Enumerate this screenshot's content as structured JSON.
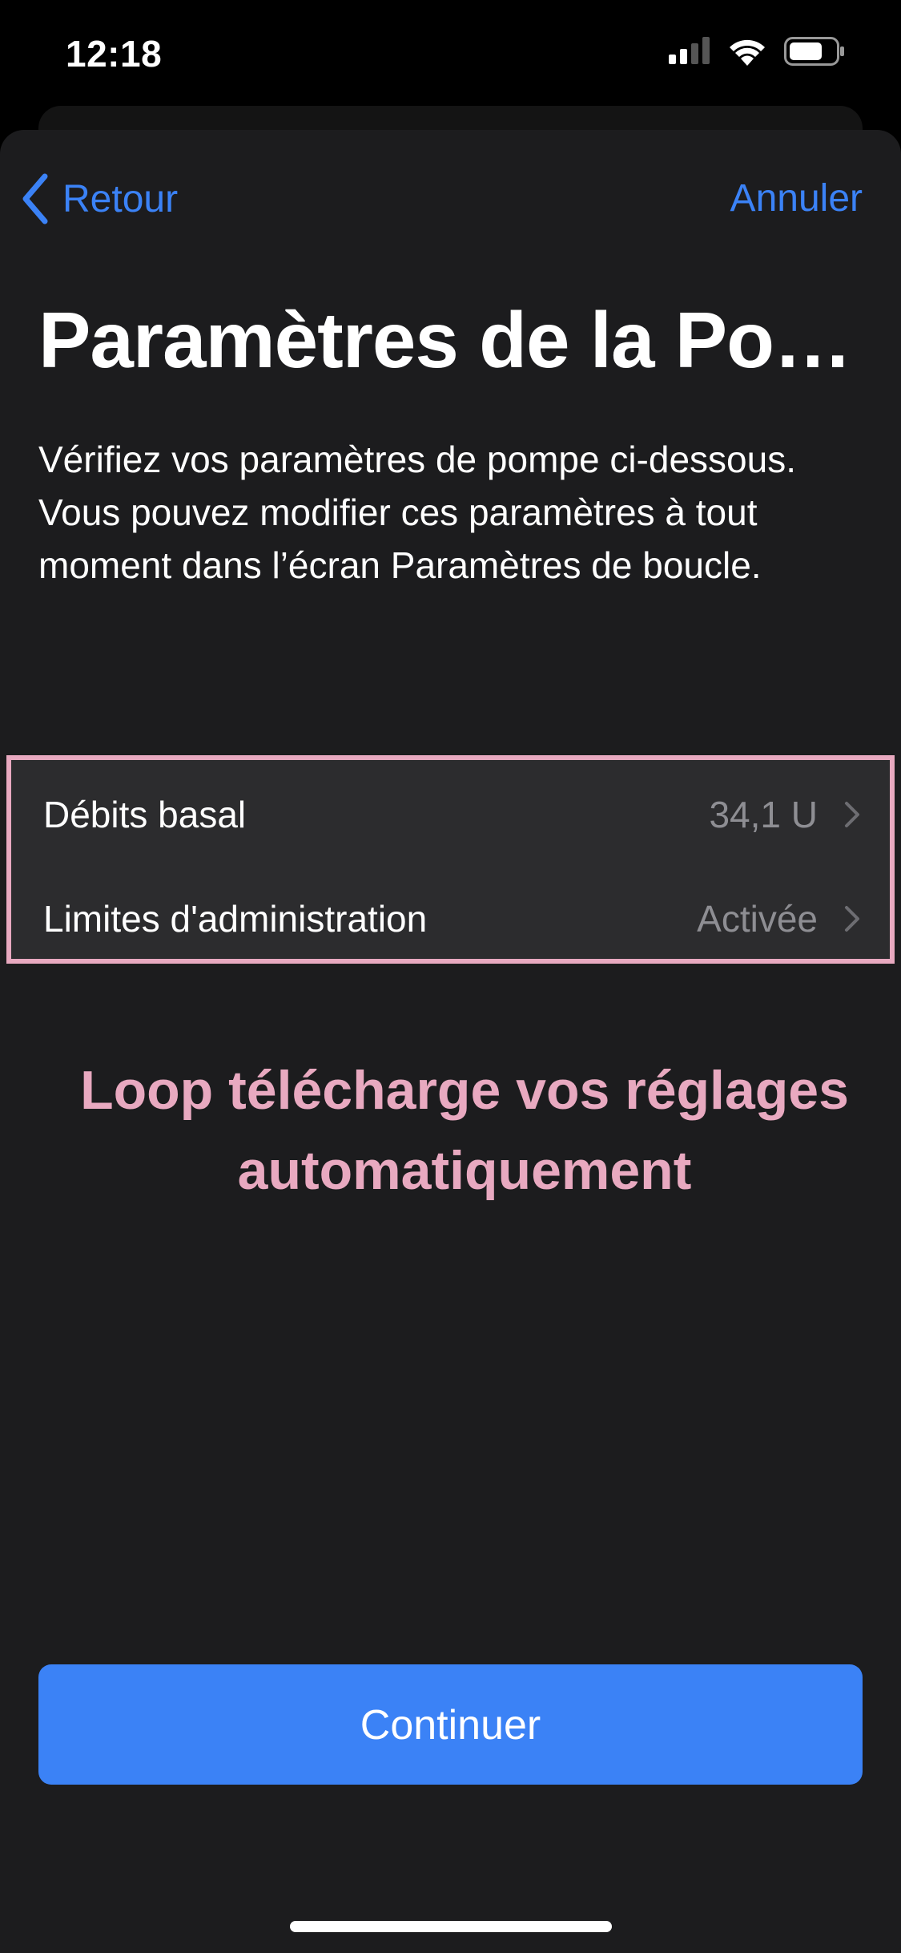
{
  "status_bar": {
    "time": "12:18"
  },
  "nav": {
    "back_label": "Retour",
    "cancel_label": "Annuler"
  },
  "page": {
    "title": "Paramètres de la Po…",
    "description": "Vérifiez vos paramètres de pompe ci-dessous. Vous pouvez modifier ces paramètres à tout moment dans l’écran Paramètres de boucle."
  },
  "settings": {
    "rows": [
      {
        "label": "Débits basal",
        "value": "34,1 U"
      },
      {
        "label": "Limites d'administration",
        "value": "Activée"
      }
    ]
  },
  "annotation": {
    "text": "Loop télécharge vos réglages automatiquement"
  },
  "footer": {
    "continue_label": "Continuer"
  },
  "colors": {
    "accent": "#3b82f6",
    "annotation": "#e8a9c0",
    "background": "#1c1c1e",
    "cell": "#2c2c2e"
  },
  "icons": [
    "chevron-left-icon",
    "chevron-right-icon",
    "signal-icon",
    "wifi-icon",
    "battery-icon"
  ]
}
